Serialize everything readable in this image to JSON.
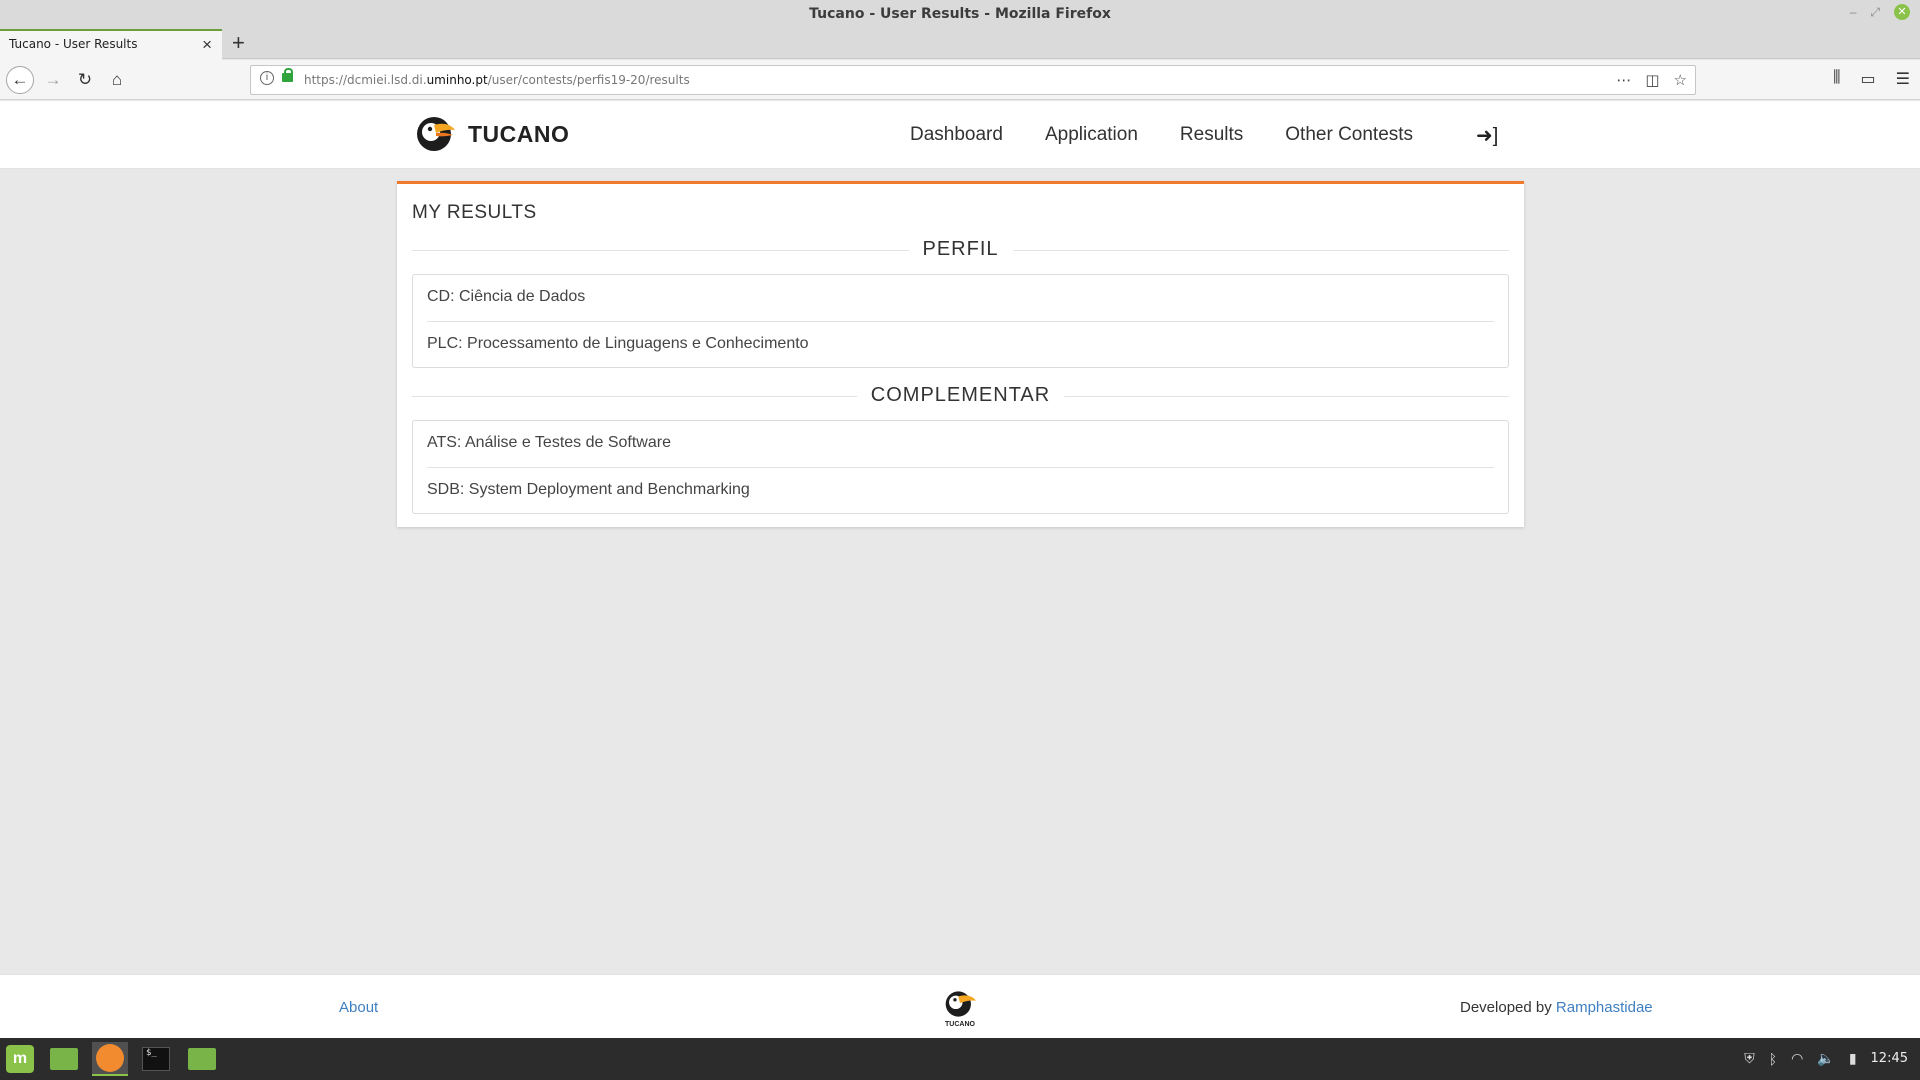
{
  "window": {
    "title": "Tucano - User Results - Mozilla Firefox"
  },
  "browser": {
    "tab_label": "Tucano - User Results",
    "url_prefix": "https://dcmiei.lsd.di.",
    "url_domain": "uminho.pt",
    "url_path": "/user/contests/perfis19-20/results"
  },
  "site": {
    "brand": "TUCANO",
    "nav": [
      "Dashboard",
      "Application",
      "Results",
      "Other Contests"
    ]
  },
  "results": {
    "title": "MY RESULTS",
    "sections": [
      {
        "heading": "PERFIL",
        "items": [
          "CD: Ciência de Dados",
          "PLC: Processamento de Linguagens e Conhecimento"
        ]
      },
      {
        "heading": "COMPLEMENTAR",
        "items": [
          "ATS: Análise e Testes de Software",
          "SDB: System Deployment and Benchmarking"
        ]
      }
    ]
  },
  "footer": {
    "about": "About",
    "logo_text": "TUCANO",
    "developed_by": "Developed by",
    "developer": "Ramphastidae"
  },
  "taskbar": {
    "clock": "12:45"
  },
  "colors": {
    "accent": "#f07a2c",
    "link": "#3f7fc1",
    "mint": "#8bc34a"
  }
}
